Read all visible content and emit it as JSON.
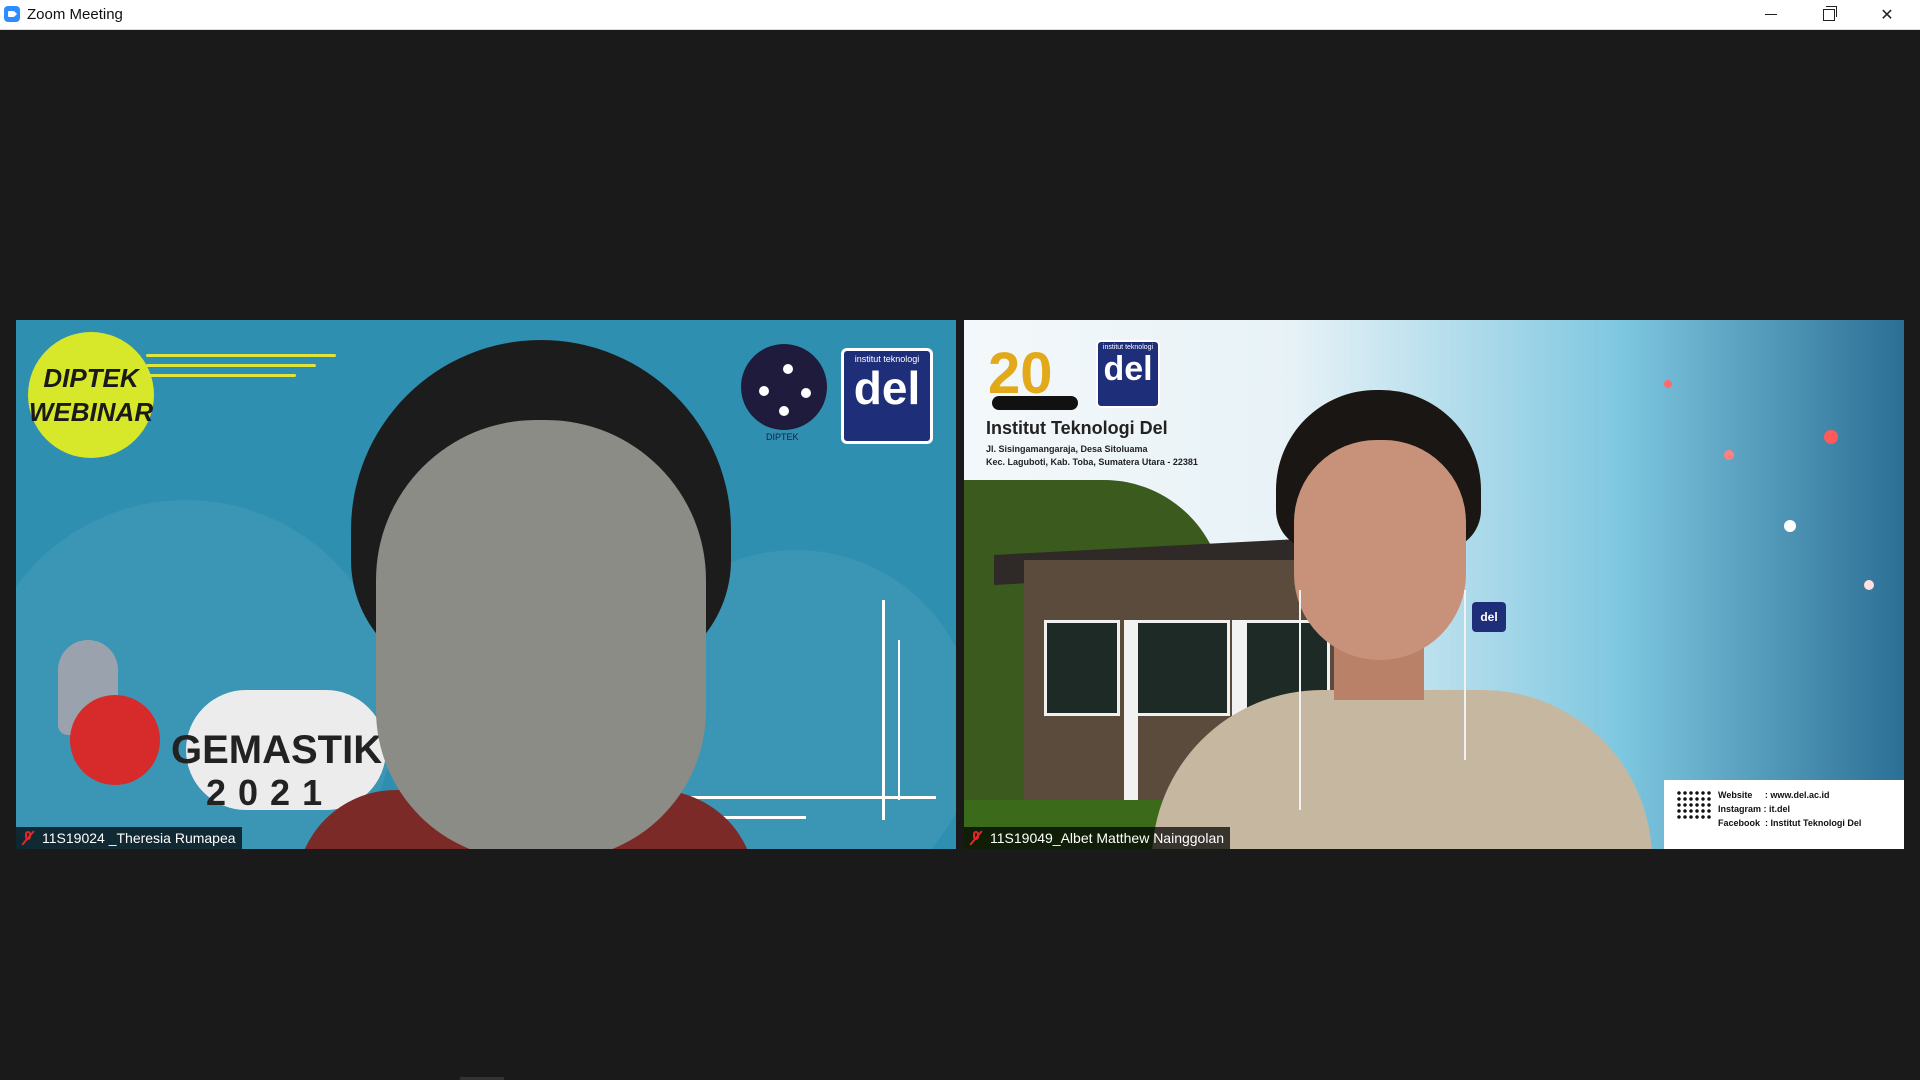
{
  "window": {
    "title": "Zoom Meeting",
    "controls": {
      "minimize": "—",
      "restore": "❐",
      "close": "✕"
    }
  },
  "participants": [
    {
      "name": "11S19024 _Theresia Rumapea",
      "muted": true,
      "background": {
        "badge_line1": "DIPTEK",
        "badge_line2": "WEBINAR",
        "event_name": "GEMASTIK",
        "event_year": "2021",
        "org_logo_text": "DIPTEK",
        "inst_logo_small": "institut teknologi",
        "inst_logo_big": "del"
      }
    },
    {
      "name": "11S19049_Albet Matthew Nainggolan",
      "muted": true,
      "background": {
        "anniv_logo_text": "20",
        "inst_logo_small": "institut teknologi",
        "inst_logo_big": "del",
        "institution": "Institut Teknologi Del",
        "address1": "Jl. Sisingamangaraja, Desa Sitoluama",
        "address2": "Kec. Laguboti, Kab. Toba, Sumatera Utara - 22381",
        "website": "Website     : www.del.ac.id",
        "instagram": "Instagram : it.del",
        "facebook": "Facebook  : Institut Teknologi Del",
        "sign_text": "del"
      }
    }
  ],
  "colors": {
    "accent": "#2d8cff",
    "mute_red": "#e02828",
    "stage_bg": "#1a1a1a"
  }
}
